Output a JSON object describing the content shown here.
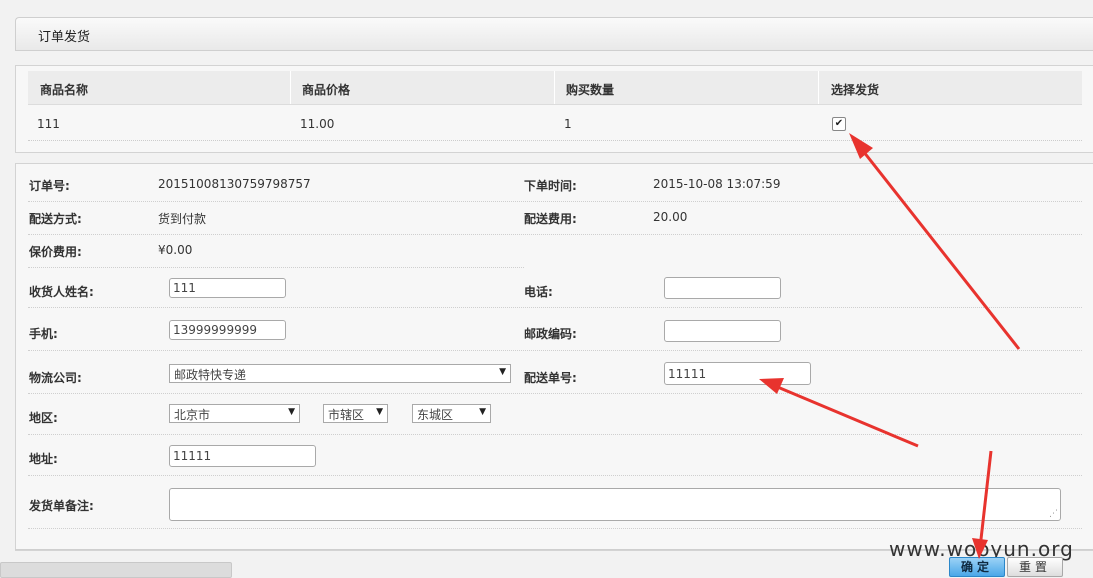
{
  "panel": {
    "title": "订单发货"
  },
  "goods_table": {
    "headers": [
      "商品名称",
      "商品价格",
      "购买数量",
      "选择发货"
    ],
    "row": {
      "name": "111",
      "price": "11.00",
      "quantity": "1",
      "checkbox": "✔"
    }
  },
  "order": {
    "order_no_label": "订单号:",
    "order_no": "20151008130759798757",
    "order_time_label": "下单时间:",
    "order_time": "2015-10-08 13:07:59",
    "delivery_method_label": "配送方式:",
    "delivery_method": "货到付款",
    "delivery_fee_label": "配送费用:",
    "delivery_fee": "20.00",
    "insurance_label": "保价费用:",
    "insurance_fee": "¥0.00",
    "receiver_name_label": "收货人姓名:",
    "receiver_name": "111",
    "phone_label": "电话:",
    "phone": "",
    "mobile_label": "手机:",
    "mobile": "13999999999",
    "postcode_label": "邮政编码:",
    "postcode": "",
    "logistics_label": "物流公司:",
    "logistics": "邮政特快专递",
    "tracking_label": "配送单号:",
    "tracking_no": "11111",
    "region_label": "地区:",
    "province": "北京市",
    "city": "市辖区",
    "district": "东城区",
    "address_label": "地址:",
    "address": "11111",
    "remark_label": "发货单备注:",
    "remark": ""
  },
  "buttons": {
    "confirm": "确定",
    "reset": "重置"
  },
  "watermark": "www.wooyun.org",
  "icons": {
    "select_arrow": "▼",
    "resize_grip": "⋰"
  },
  "annotation_color": "#e8332e"
}
